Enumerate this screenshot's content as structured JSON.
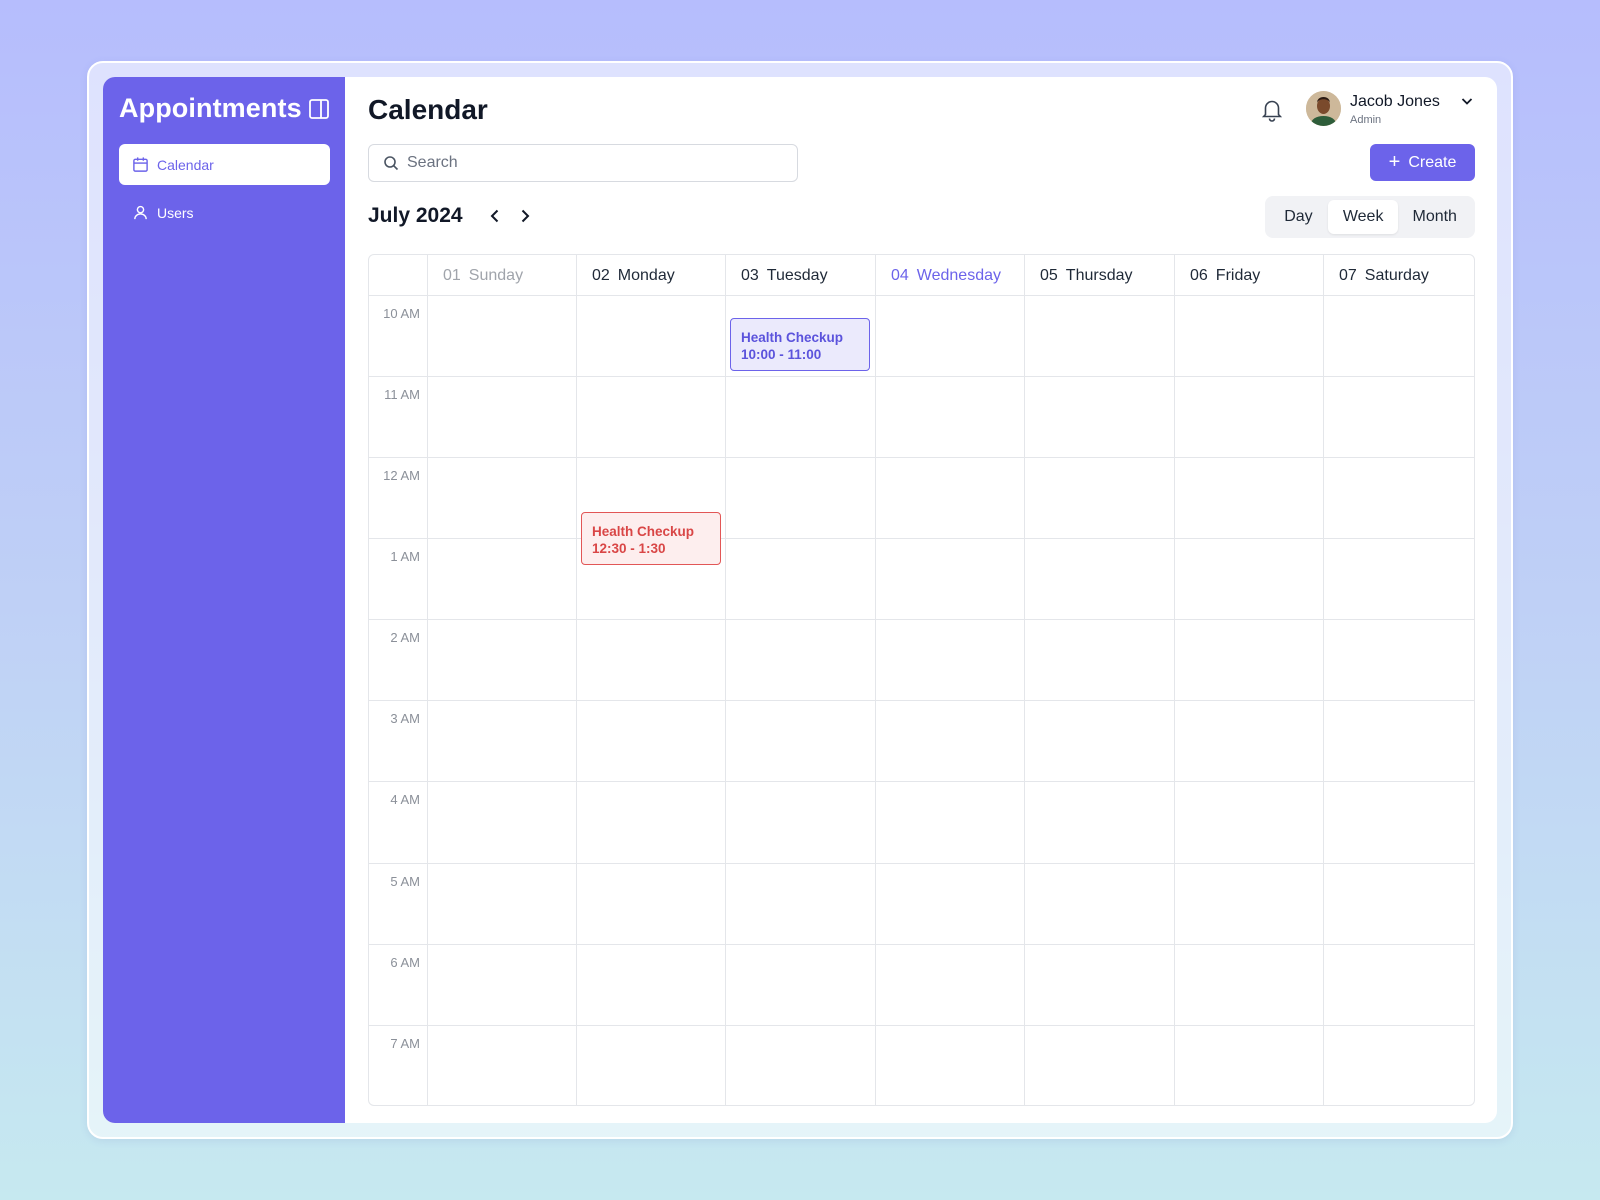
{
  "sidebar": {
    "brand": "Appointments",
    "items": [
      {
        "label": "Calendar",
        "icon": "calendar-icon",
        "active": true
      },
      {
        "label": "Users",
        "icon": "user-icon",
        "active": false
      }
    ]
  },
  "header": {
    "title": "Calendar",
    "user": {
      "name": "Jacob Jones",
      "role": "Admin"
    }
  },
  "search": {
    "placeholder": "Search",
    "value": ""
  },
  "toolbar": {
    "create_label": "Create",
    "month_label": "July 2024",
    "views": [
      "Day",
      "Week",
      "Month"
    ],
    "active_view": "Week"
  },
  "calendar": {
    "days": [
      {
        "num": "01",
        "name": "Sunday",
        "state": "past"
      },
      {
        "num": "02",
        "name": "Monday",
        "state": "normal"
      },
      {
        "num": "03",
        "name": "Tuesday",
        "state": "normal"
      },
      {
        "num": "04",
        "name": "Wednesday",
        "state": "today"
      },
      {
        "num": "05",
        "name": "Thursday",
        "state": "normal"
      },
      {
        "num": "06",
        "name": "Friday",
        "state": "normal"
      },
      {
        "num": "07",
        "name": "Saturday",
        "state": "normal"
      }
    ],
    "hours": [
      "10 AM",
      "11 AM",
      "12 AM",
      "1 AM",
      "2 AM",
      "3 AM",
      "4 AM",
      "5 AM",
      "6 AM",
      "7 AM"
    ],
    "events": [
      {
        "title": "Health Checkup",
        "time": "10:00 - 11:00",
        "day": "03 Tuesday",
        "color": "#6c63ea"
      },
      {
        "title": "Health Checkup",
        "time": "12:30 - 1:30",
        "day": "02 Monday",
        "color": "#e25656"
      }
    ]
  },
  "colors": {
    "accent": "#6c63ea",
    "today": "#6c63ea",
    "event_blue": "#6c63ea",
    "event_red": "#e25656"
  }
}
